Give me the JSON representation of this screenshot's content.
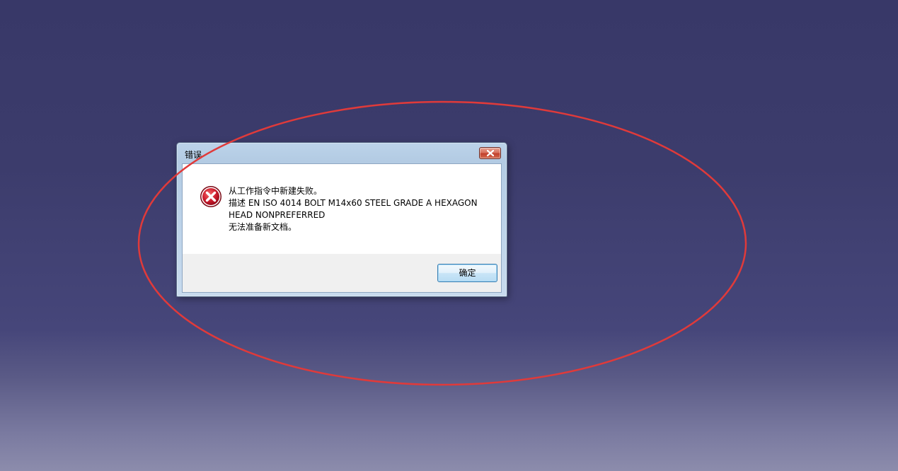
{
  "dialog": {
    "title": "错误",
    "message_lines": [
      "从工作指令中新建失败。",
      "描述 EN ISO 4014 BOLT M14x60 STEEL GRADE A HEXAGON",
      "HEAD NONPREFERRED",
      "无法准备新文档。"
    ],
    "ok_label": "确定",
    "icons": {
      "status": "error-icon",
      "close": "close-icon"
    }
  },
  "colors": {
    "annotation_ellipse": "#e03a3a",
    "error_icon": "#c8102e",
    "close_button": "#c2412c"
  }
}
